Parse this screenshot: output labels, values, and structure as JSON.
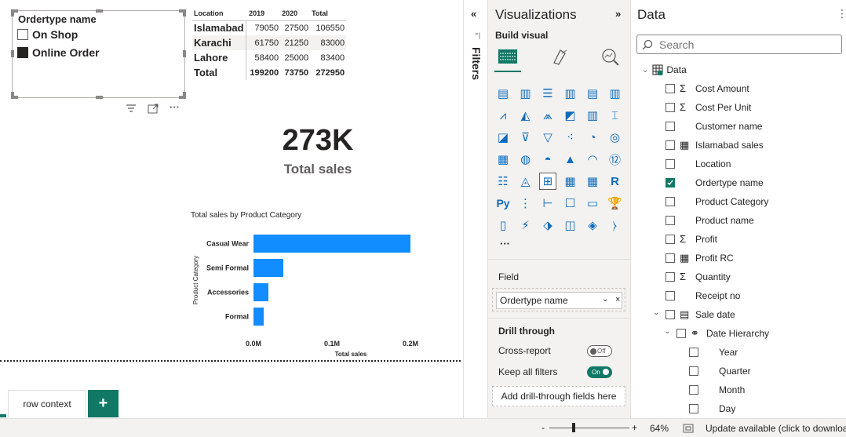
{
  "slicer": {
    "title": "Ordertype name",
    "options": [
      {
        "label": "On Shop",
        "checked": false
      },
      {
        "label": "Online Order",
        "checked": true
      }
    ],
    "actions": {
      "filter_icon": "filter-icon",
      "focus_icon": "focus-mode-icon",
      "more": "···"
    }
  },
  "matrix": {
    "headers": [
      "Location",
      "2019",
      "2020",
      "Total"
    ],
    "rows": [
      {
        "location": "Islamabad",
        "y2019": "79050",
        "y2020": "27500",
        "total": "106550"
      },
      {
        "location": "Karachi",
        "y2019": "61750",
        "y2020": "21250",
        "total": "83000"
      },
      {
        "location": "Lahore",
        "y2019": "58400",
        "y2020": "25000",
        "total": "83400"
      },
      {
        "location": "Total",
        "y2019": "199200",
        "y2020": "73750",
        "total": "272950"
      }
    ]
  },
  "card": {
    "value": "273K",
    "label": "Total sales"
  },
  "chart_data": {
    "type": "bar",
    "orientation": "horizontal",
    "title": "Total sales by Product Category",
    "xlabel": "Total sales",
    "ylabel": "Product Category",
    "categories": [
      "Casual Wear",
      "Semi Formal",
      "Accessories",
      "Formal"
    ],
    "values": [
      200000,
      38000,
      19000,
      13000
    ],
    "xlim": [
      0,
      200000
    ],
    "ticks": [
      "0.0M",
      "0.1M",
      "0.2M"
    ],
    "color": "#118dff",
    "grid": false
  },
  "pages": {
    "tab_label": "row context",
    "add_label": "+"
  },
  "filters": {
    "label": "Filters",
    "collapse_icon": "«",
    "expand_icon": "»"
  },
  "visualizations": {
    "title": "Visualizations",
    "expand_icon": "»",
    "build_visual": "Build visual",
    "more": "···",
    "field_label": "Field",
    "field_value": "Ordertype name",
    "drill_through": "Drill through",
    "cross_report": "Cross-report",
    "cross_report_state": "Off",
    "keep_filters": "Keep all filters",
    "keep_filters_state": "On",
    "add_drill": "Add drill-through fields here"
  },
  "data_pane": {
    "title": "Data",
    "more": "⋮",
    "search_placeholder": "Search",
    "table_name": "Data",
    "fields": [
      {
        "label": "Cost Amount",
        "icon": "Σ",
        "checked": false
      },
      {
        "label": "Cost Per Unit",
        "icon": "Σ",
        "checked": false
      },
      {
        "label": "Customer name",
        "icon": "",
        "checked": false
      },
      {
        "label": "Islamabad sales",
        "icon": "▦",
        "checked": false
      },
      {
        "label": "Location",
        "icon": "",
        "checked": false
      },
      {
        "label": "Ordertype name",
        "icon": "",
        "checked": true
      },
      {
        "label": "Product Category",
        "icon": "",
        "checked": false
      },
      {
        "label": "Product name",
        "icon": "",
        "checked": false
      },
      {
        "label": "Profit",
        "icon": "Σ",
        "checked": false
      },
      {
        "label": "Profit RC",
        "icon": "▦",
        "checked": false
      },
      {
        "label": "Quantity",
        "icon": "Σ",
        "checked": false
      },
      {
        "label": "Receipt no",
        "icon": "",
        "checked": false
      },
      {
        "label": "Sale date",
        "icon": "▤",
        "checked": false
      },
      {
        "label": "Date Hierarchy",
        "icon": "⚭",
        "checked": false
      },
      {
        "label": "Year",
        "icon": "",
        "checked": false
      },
      {
        "label": "Quarter",
        "icon": "",
        "checked": false
      },
      {
        "label": "Month",
        "icon": "",
        "checked": false
      },
      {
        "label": "Day",
        "icon": "",
        "checked": false
      }
    ]
  },
  "status": {
    "zoom_minus": "-",
    "zoom_plus": "+",
    "zoom_level": "64%",
    "update_text": "Update available (click to download"
  }
}
